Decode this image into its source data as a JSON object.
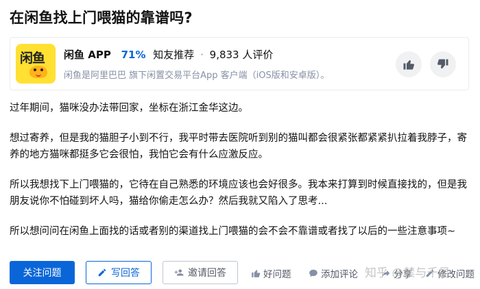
{
  "question": {
    "title": "在闲鱼找上门喂猫的靠谱吗?"
  },
  "app_card": {
    "logo_text": "闲鱼",
    "name": "闲鱼 APP",
    "percent": "71%",
    "recommend_text": "知友推荐",
    "dot": "·",
    "rating_text": "9,833 人评价",
    "description": "闲鱼是阿里巴巴 旗下闲置交易平台App 客户端（iOS版和安卓版）。",
    "vote_up_icon": "thumbs-up-icon",
    "vote_down_icon": "thumbs-down-icon"
  },
  "body": {
    "p1": "过年期间，猫咪没办法带回家，坐标在浙江金华这边。",
    "p2": "想过寄养，但是我的猫胆子小到不行，我平时带去医院听到别的猫叫都会很紧张都紧紧扒拉着我脖子，寄养的地方猫咪都挺多它会很怕，我怕它会有什么应激反应。",
    "p3": "所以我想找下上门喂猫的，它待在自己熟悉的环境应该也会好很多。我本来打算到时候直接找的，但是我朋友说你不怕碰到坏人吗，猫给你偷走怎么办？然后我就又陷入了思考...",
    "p4": "所以想问问在闲鱼上面找的话或者别的渠道找上门喂猫的会不会不靠谱或者找了以后的一些注意事项~"
  },
  "actions": {
    "follow": "关注问题",
    "write_answer": "写回答",
    "invite": "邀请回答",
    "good_question": "好问题",
    "add_comment": "添加评论",
    "share": "分享",
    "more": "修改问题"
  },
  "watermark": "知乎 @禁与千易"
}
